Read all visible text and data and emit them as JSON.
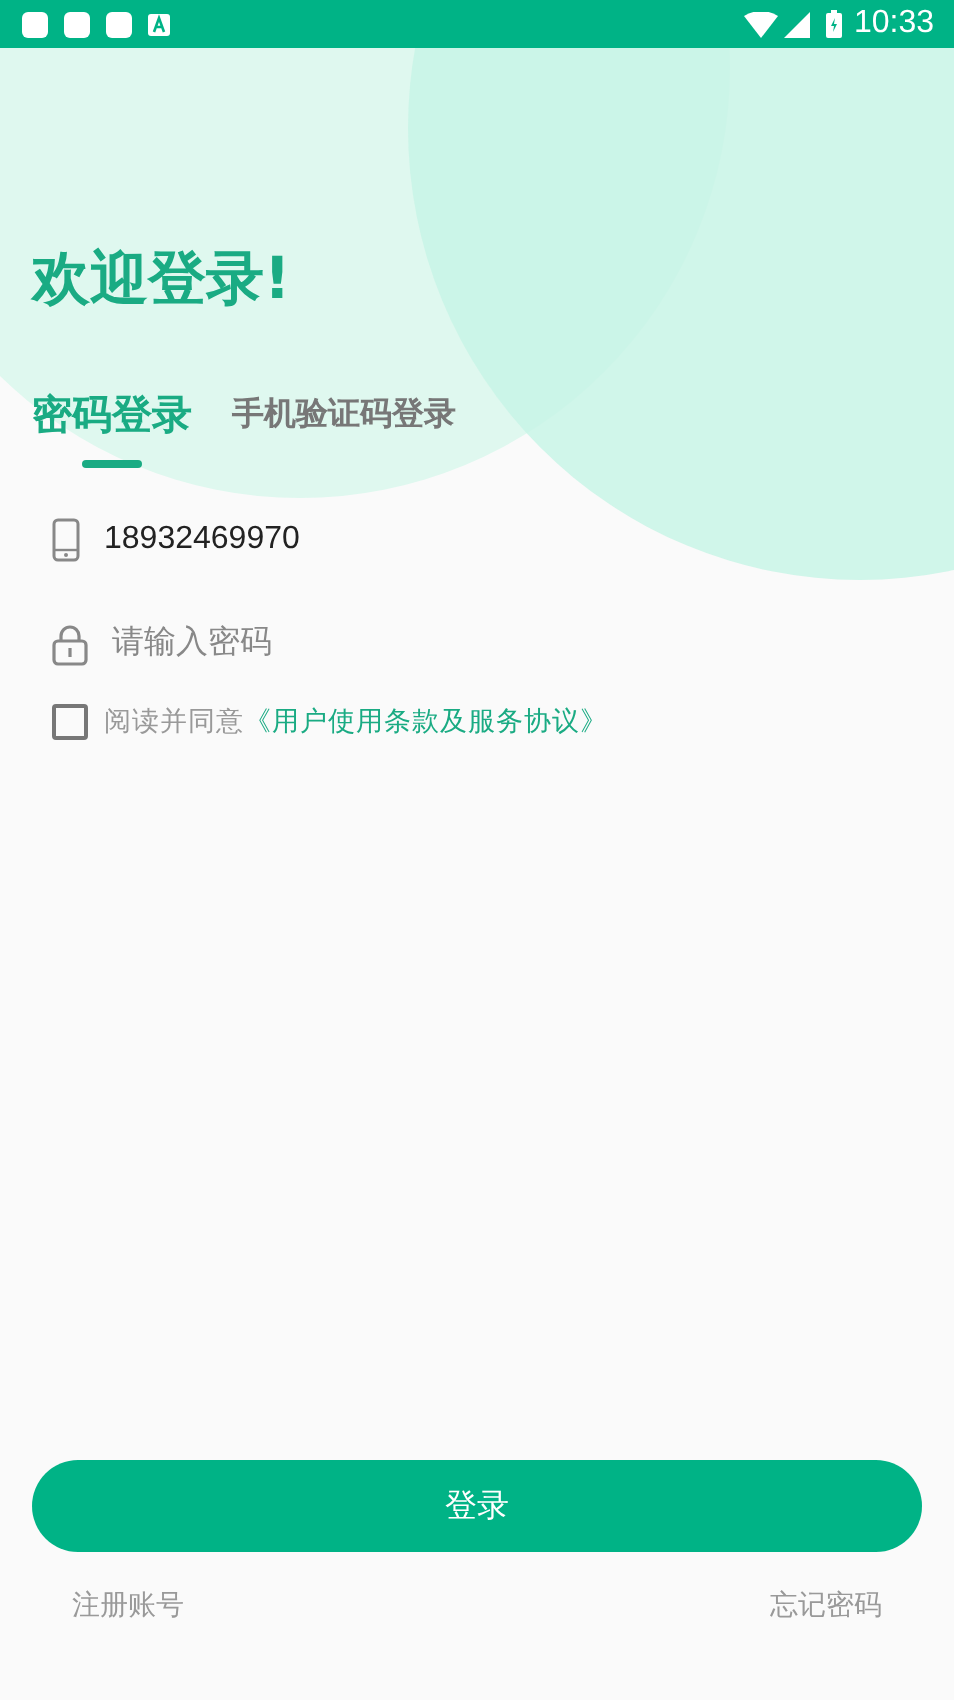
{
  "status_bar": {
    "time": "10:33"
  },
  "title": "欢迎登录!",
  "tabs": [
    {
      "label": "密码登录",
      "selected": true
    },
    {
      "label": "手机验证码登录",
      "selected": false
    }
  ],
  "phone_field": {
    "value": "18932469970"
  },
  "password_field": {
    "placeholder": "请输入密码"
  },
  "agreement": {
    "checked": false,
    "text": "阅读并同意",
    "link": "《用户使用条款及服务协议》"
  },
  "login_button": "登录",
  "footer": {
    "register": "注册账号",
    "forgot": "忘记密码"
  }
}
